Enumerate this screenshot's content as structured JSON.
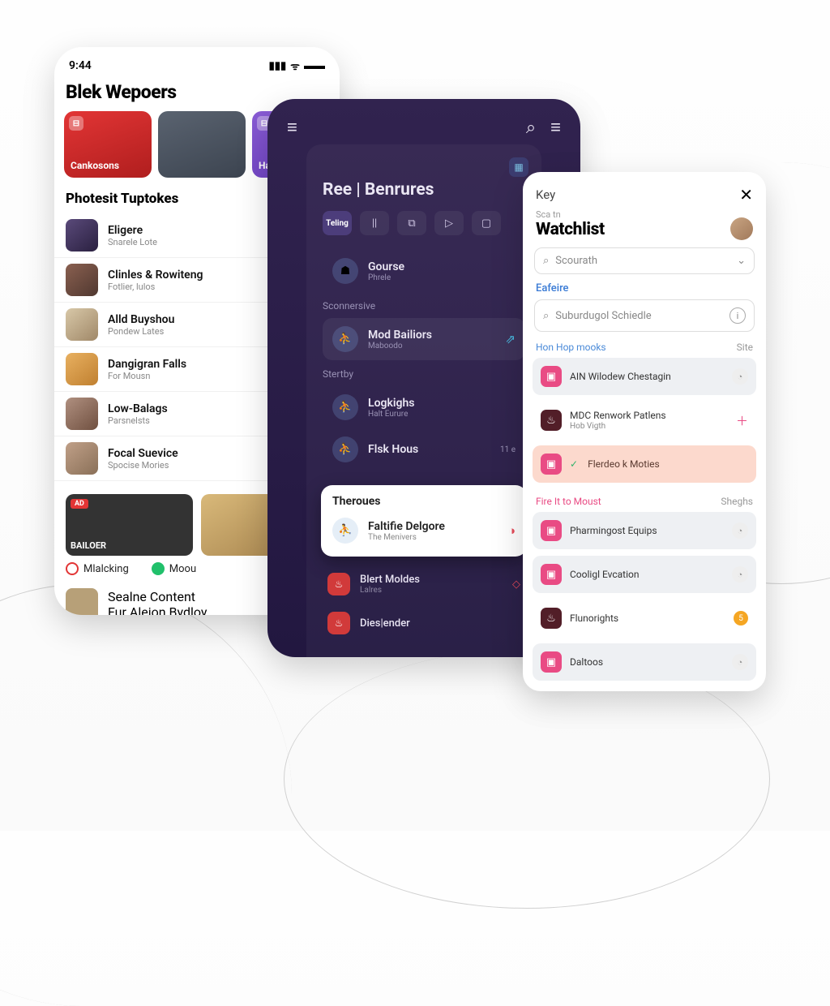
{
  "phone1": {
    "status_time": "9:44",
    "title": "Blek Wepoers",
    "featured": [
      {
        "label": "Cankosons"
      },
      {
        "label": ""
      },
      {
        "label": "Hap"
      }
    ],
    "section1_title": "Photesit Tuptokes",
    "list": [
      {
        "title": "Eligere",
        "sub": "Snarele Lote"
      },
      {
        "title": "Clinles & Rowiteng",
        "sub": "Fotlier, lulos"
      },
      {
        "title": "Alld Buyshou",
        "sub": "Pondew Lates"
      },
      {
        "title": "Dangigran Falls",
        "sub": "For Mousn"
      },
      {
        "title": "Low-Balags",
        "sub": "Parsnelsts"
      },
      {
        "title": "Focal Suevice",
        "sub": "Spocise Mories"
      }
    ],
    "bigcards": [
      {
        "label": "BAILOER",
        "ad": "AD"
      },
      {
        "label": ""
      }
    ],
    "chips": [
      {
        "label": "Mlalcking"
      },
      {
        "label": "Moou"
      }
    ],
    "bottom": {
      "title": "Sealne Content",
      "sub": "Fur Aleion Bydloy"
    }
  },
  "phone2": {
    "title": "Ree | Benrures",
    "tabs": [
      "Teling",
      "||",
      "⧉",
      "▷",
      "▢"
    ],
    "sect_label": "Sconnersive",
    "rows1": [
      {
        "title": "Gourse",
        "sub": "Phrele"
      },
      {
        "title": "Mod Bailiors",
        "sub": "Maboodo"
      }
    ],
    "sect2_label": "Stertby",
    "rows2": [
      {
        "title": "Logkighs",
        "sub": "Halt Eurure"
      },
      {
        "title": "Flsk Hous",
        "sub": "",
        "time": "11 e"
      }
    ],
    "bump_heading": "Theroues",
    "bump": {
      "title": "Faltifie Delgore",
      "sub": "The Menivers"
    },
    "dark": [
      {
        "title": "Blert Moldes",
        "sub": "Lalres"
      },
      {
        "title": "Dies|ender",
        "sub": ""
      }
    ]
  },
  "phone3": {
    "key": "Key",
    "sub": "Sca tn",
    "title": "Watchlist",
    "search_placeholder": "Scourath",
    "link_label": "Eafeire",
    "search2_placeholder": "Suburdugol Schiedle",
    "group1": {
      "title": "Hon Hop mooks",
      "right": "Site"
    },
    "items1": [
      {
        "title": "AIN Wilodew Chestagin"
      },
      {
        "title": "MDC Renwork Patlens",
        "sub": "Hob Vigth"
      },
      {
        "title": "Flerdeo k Moties"
      }
    ],
    "group2": {
      "title": "Fire It to Moust",
      "right": "Sheghs"
    },
    "items2": [
      {
        "title": "Pharmingost Equips"
      },
      {
        "title": "Cooligl Evcation"
      },
      {
        "title": "Flunorights",
        "badge": "5"
      },
      {
        "title": "Daltoos"
      }
    ]
  }
}
